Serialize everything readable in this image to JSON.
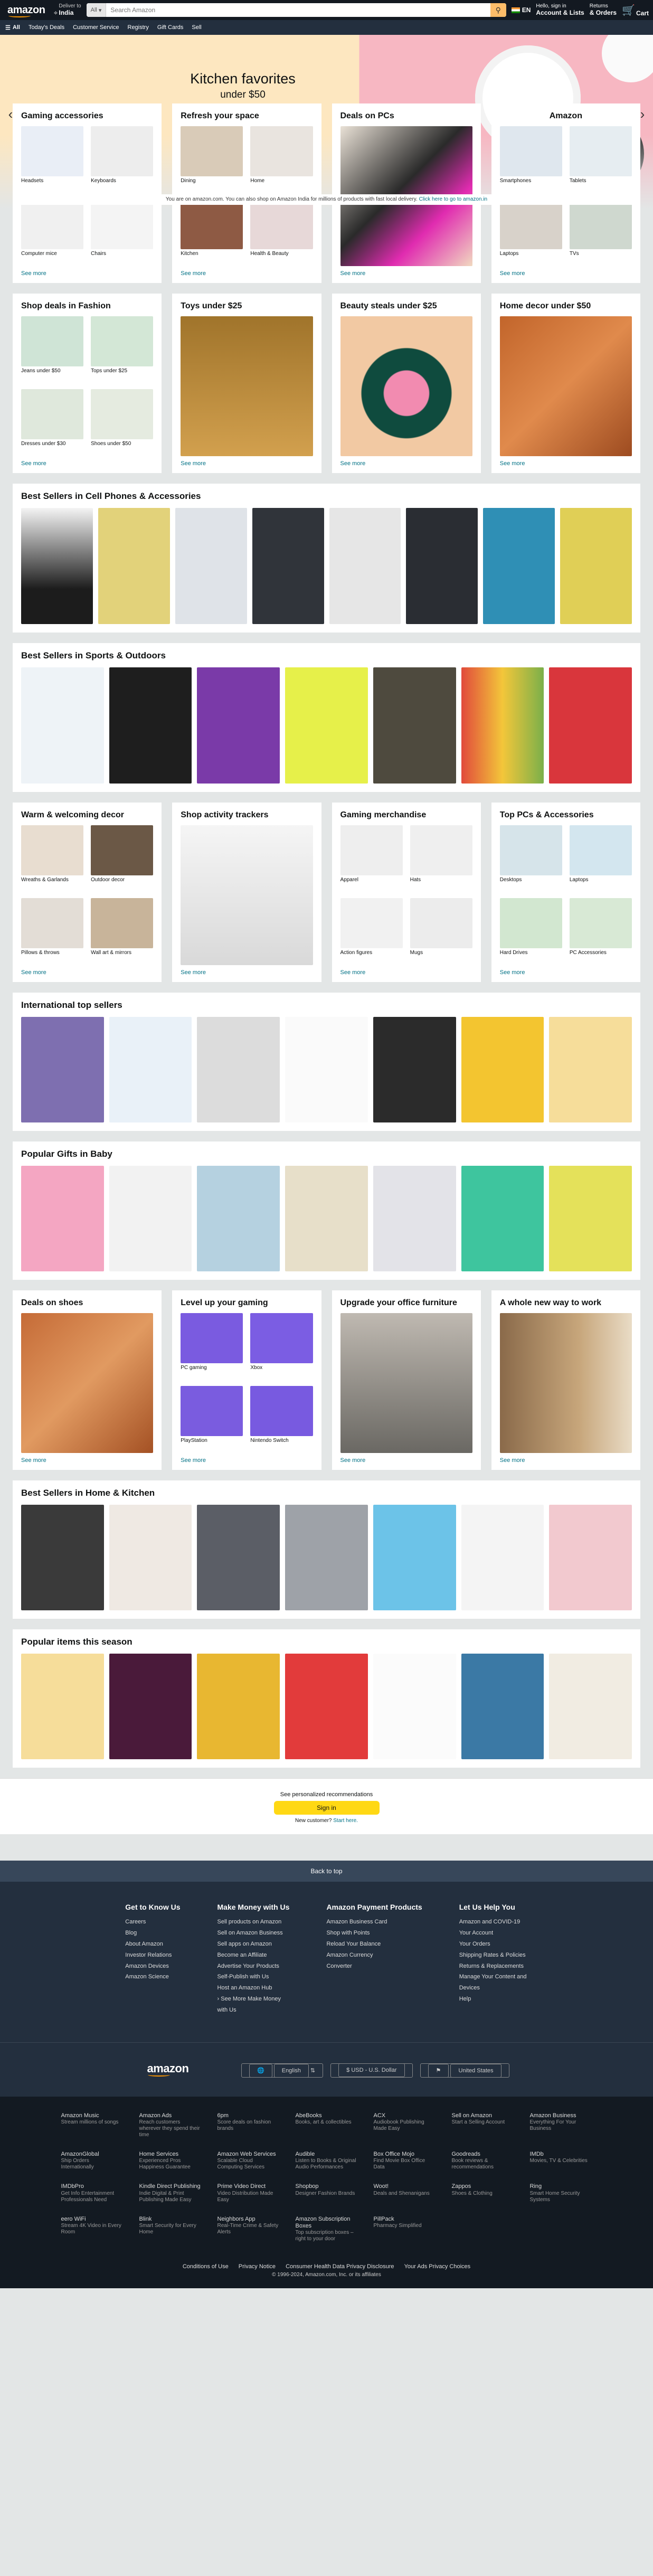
{
  "header": {
    "logo": "amazon",
    "deliver_label": "Deliver to",
    "deliver_loc": "India",
    "search_cat": "All",
    "search_placeholder": "Search Amazon",
    "lang": "EN",
    "hello": "Hello, sign in",
    "account": "Account & Lists",
    "returns": "Returns",
    "orders": "& Orders",
    "cart": "Cart"
  },
  "nav": {
    "all": "All",
    "links": [
      "Today's Deals",
      "Customer Service",
      "Registry",
      "Gift Cards",
      "Sell"
    ]
  },
  "hero": {
    "title": "Kitchen favorites",
    "subtitle": "under $50"
  },
  "notice": {
    "text": "You are on amazon.com. You can also shop on Amazon India for millions of products with fast local delivery.",
    "link": "Click here to go to amazon.in"
  },
  "cards_row1": [
    {
      "title": "Gaming accessories",
      "items": [
        "Headsets",
        "Keyboards",
        "Computer mice",
        "Chairs"
      ],
      "more": "See more"
    },
    {
      "title": "Refresh your space",
      "items": [
        "Dining",
        "Home",
        "Kitchen",
        "Health & Beauty"
      ],
      "more": "See more"
    },
    {
      "title": "Deals on PCs",
      "more": "See more"
    },
    {
      "title": "Amazon",
      "items": [
        "Smartphones",
        "Tablets",
        "Laptops",
        "TVs"
      ],
      "more": "See more"
    }
  ],
  "cards_row2": [
    {
      "title": "Shop deals in Fashion",
      "items": [
        "Jeans under $50",
        "Tops under $25",
        "Dresses under $30",
        "Shoes under $50"
      ],
      "more": "See more"
    },
    {
      "title": "Toys under $25",
      "more": "See more"
    },
    {
      "title": "Beauty steals under $25",
      "more": "See more"
    },
    {
      "title": "Home decor under $50",
      "more": "See more"
    }
  ],
  "row_cell": {
    "title": "Best Sellers in Cell Phones & Accessories"
  },
  "row_sports": {
    "title": "Best Sellers in Sports & Outdoors"
  },
  "cards_row3": [
    {
      "title": "Warm & welcoming decor",
      "items": [
        "Wreaths & Garlands",
        "Outdoor decor",
        "Pillows & throws",
        "Wall art & mirrors"
      ],
      "more": "See more"
    },
    {
      "title": "Shop activity trackers",
      "more": "See more"
    },
    {
      "title": "Gaming merchandise",
      "items": [
        "Apparel",
        "Hats",
        "Action figures",
        "Mugs"
      ],
      "more": "See more"
    },
    {
      "title": "Top PCs & Accessories",
      "items": [
        "Desktops",
        "Laptops",
        "Hard Drives",
        "PC Accessories"
      ],
      "more": "See more"
    }
  ],
  "row_intl": {
    "title": "International top sellers"
  },
  "row_baby": {
    "title": "Popular Gifts in Baby"
  },
  "cards_row4": [
    {
      "title": "Deals on shoes",
      "more": "See more"
    },
    {
      "title": "Level up your gaming",
      "items": [
        "PC gaming",
        "Xbox",
        "PlayStation",
        "Nintendo Switch"
      ],
      "more": "See more"
    },
    {
      "title": "Upgrade your office furniture",
      "more": "See more"
    },
    {
      "title": "A whole new way to work",
      "more": "See more"
    }
  ],
  "row_home": {
    "title": "Best Sellers in Home & Kitchen"
  },
  "row_season": {
    "title": "Popular items this season"
  },
  "signin": {
    "text": "See personalized recommendations",
    "button": "Sign in",
    "new_customer": "New customer?",
    "start": "Start here."
  },
  "backtop": "Back to top",
  "footer_cols": [
    {
      "title": "Get to Know Us",
      "links": [
        "Careers",
        "Blog",
        "About Amazon",
        "Investor Relations",
        "Amazon Devices",
        "Amazon Science"
      ]
    },
    {
      "title": "Make Money with Us",
      "links": [
        "Sell products on Amazon",
        "Sell on Amazon Business",
        "Sell apps on Amazon",
        "Become an Affiliate",
        "Advertise Your Products",
        "Self-Publish with Us",
        "Host an Amazon Hub",
        "› See More Make Money with Us"
      ]
    },
    {
      "title": "Amazon Payment Products",
      "links": [
        "Amazon Business Card",
        "Shop with Points",
        "Reload Your Balance",
        "Amazon Currency Converter"
      ]
    },
    {
      "title": "Let Us Help You",
      "links": [
        "Amazon and COVID-19",
        "Your Account",
        "Your Orders",
        "Shipping Rates & Policies",
        "Returns & Replacements",
        "Manage Your Content and Devices",
        "Help"
      ]
    }
  ],
  "footer_select": {
    "lang": "English",
    "currency": "$ USD - U.S. Dollar",
    "country": "United States"
  },
  "footer_grid": [
    {
      "t": "Amazon Music",
      "d": "Stream millions of songs"
    },
    {
      "t": "Amazon Ads",
      "d": "Reach customers wherever they spend their time"
    },
    {
      "t": "6pm",
      "d": "Score deals on fashion brands"
    },
    {
      "t": "AbeBooks",
      "d": "Books, art & collectibles"
    },
    {
      "t": "ACX",
      "d": "Audiobook Publishing Made Easy"
    },
    {
      "t": "Sell on Amazon",
      "d": "Start a Selling Account"
    },
    {
      "t": "Amazon Business",
      "d": "Everything For Your Business"
    },
    {
      "t": "AmazonGlobal",
      "d": "Ship Orders Internationally"
    },
    {
      "t": "Home Services",
      "d": "Experienced Pros Happiness Guarantee"
    },
    {
      "t": "Amazon Web Services",
      "d": "Scalable Cloud Computing Services"
    },
    {
      "t": "Audible",
      "d": "Listen to Books & Original Audio Performances"
    },
    {
      "t": "Box Office Mojo",
      "d": "Find Movie Box Office Data"
    },
    {
      "t": "Goodreads",
      "d": "Book reviews & recommendations"
    },
    {
      "t": "IMDb",
      "d": "Movies, TV & Celebrities"
    },
    {
      "t": "IMDbPro",
      "d": "Get Info Entertainment Professionals Need"
    },
    {
      "t": "Kindle Direct Publishing",
      "d": "Indie Digital & Print Publishing Made Easy"
    },
    {
      "t": "Prime Video Direct",
      "d": "Video Distribution Made Easy"
    },
    {
      "t": "Shopbop",
      "d": "Designer Fashion Brands"
    },
    {
      "t": "Woot!",
      "d": "Deals and Shenanigans"
    },
    {
      "t": "Zappos",
      "d": "Shoes & Clothing"
    },
    {
      "t": "Ring",
      "d": "Smart Home Security Systems"
    },
    {
      "t": "eero WiFi",
      "d": "Stream 4K Video in Every Room"
    },
    {
      "t": "Blink",
      "d": "Smart Security for Every Home"
    },
    {
      "t": "Neighbors App",
      "d": "Real-Time Crime & Safety Alerts"
    },
    {
      "t": "Amazon Subscription Boxes",
      "d": "Top subscription boxes – right to your door"
    },
    {
      "t": "PillPack",
      "d": "Pharmacy Simplified"
    }
  ],
  "legal": [
    "Conditions of Use",
    "Privacy Notice",
    "Consumer Health Data Privacy Disclosure",
    "Your Ads Privacy Choices"
  ],
  "copyright": "© 1996-2024, Amazon.com, Inc. or its affiliates",
  "colors": {
    "nav": "#131921",
    "nav2": "#232f3e",
    "accent": "#febd69",
    "link": "#007185"
  }
}
